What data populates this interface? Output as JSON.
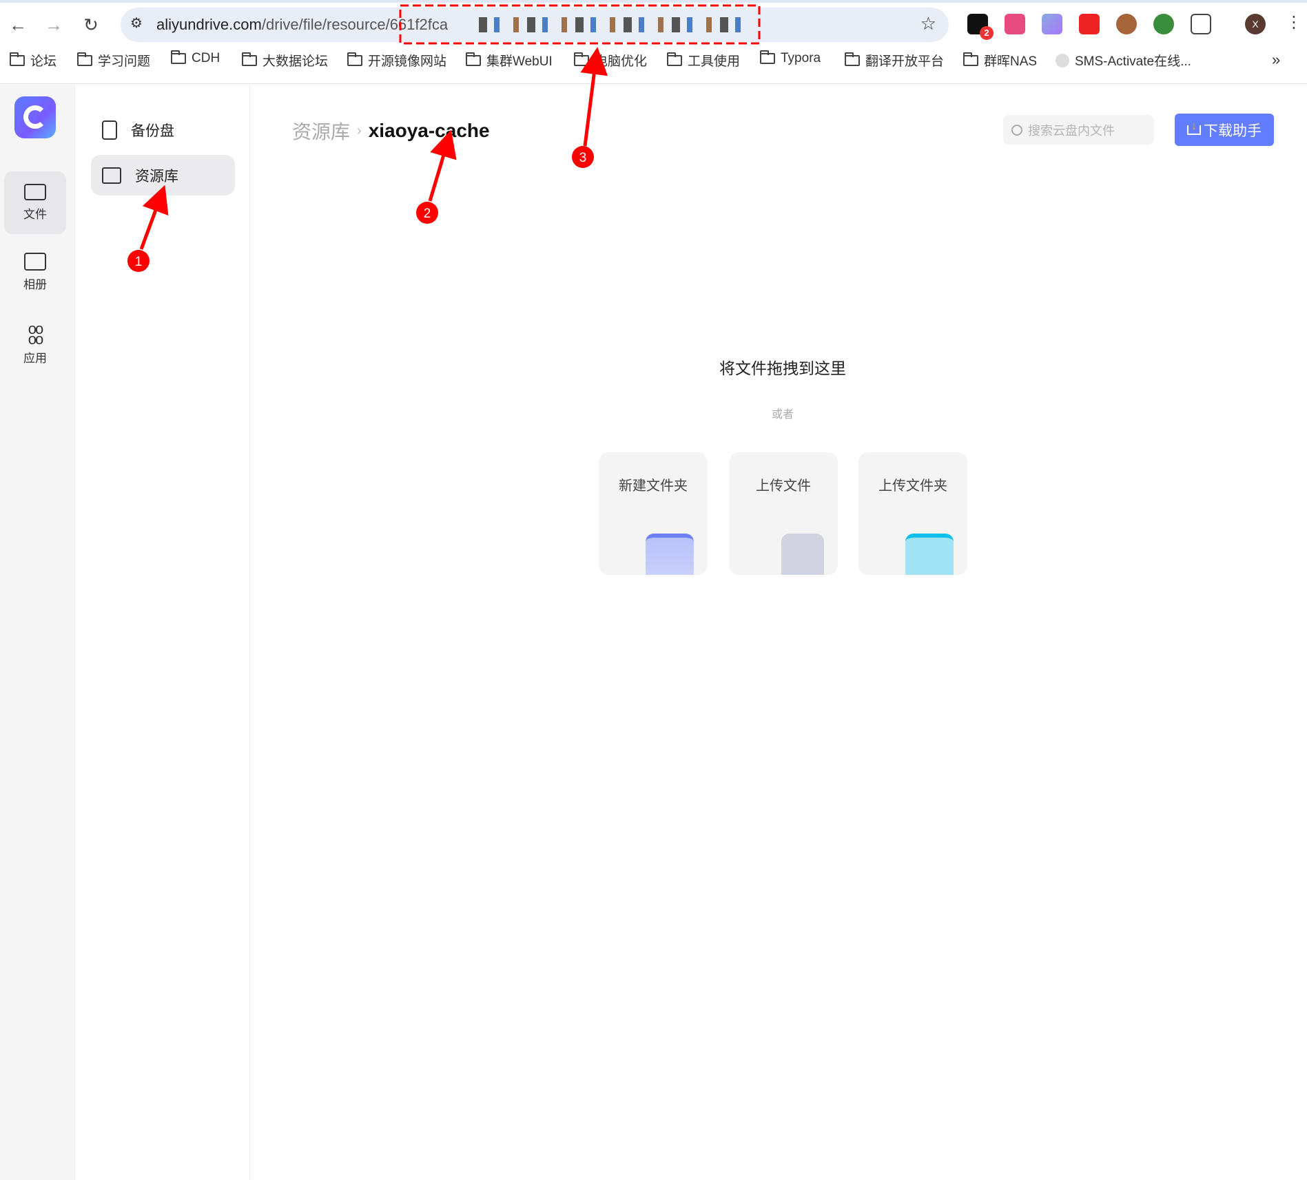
{
  "browser": {
    "url_host": "aliyundrive.com",
    "url_path": "/drive/file/resource/661f2fca",
    "extension_badge": "2",
    "profile_initial": "X",
    "bookmarks": [
      "论坛",
      "学习问题",
      "CDH",
      "大数据论坛",
      "开源镜像网站",
      "集群WebUI",
      "电脑优化",
      "工具使用",
      "Typora",
      "翻译开放平台",
      "群晖NAS",
      "SMS-Activate在线..."
    ],
    "more_bookmarks": "»"
  },
  "rail": {
    "items": [
      {
        "label": "文件",
        "active": true
      },
      {
        "label": "相册"
      },
      {
        "label": "应用"
      }
    ]
  },
  "sidebar": {
    "items": [
      {
        "label": "备份盘"
      },
      {
        "label": "资源库",
        "active": true
      }
    ]
  },
  "breadcrumb": {
    "root": "资源库",
    "separator": "›",
    "current": "xiaoya-cache"
  },
  "search": {
    "placeholder": "搜索云盘内文件"
  },
  "download_button": "下载助手",
  "empty_state": {
    "title": "将文件拖拽到这里",
    "or": "或者",
    "actions": [
      {
        "label": "新建文件夹"
      },
      {
        "label": "上传文件"
      },
      {
        "label": "上传文件夹"
      }
    ]
  },
  "annotations": {
    "markers": [
      "1",
      "2",
      "3"
    ],
    "color": "#ff0000"
  },
  "colors": {
    "accent": "#637dff",
    "annotation": "#ff0000"
  }
}
